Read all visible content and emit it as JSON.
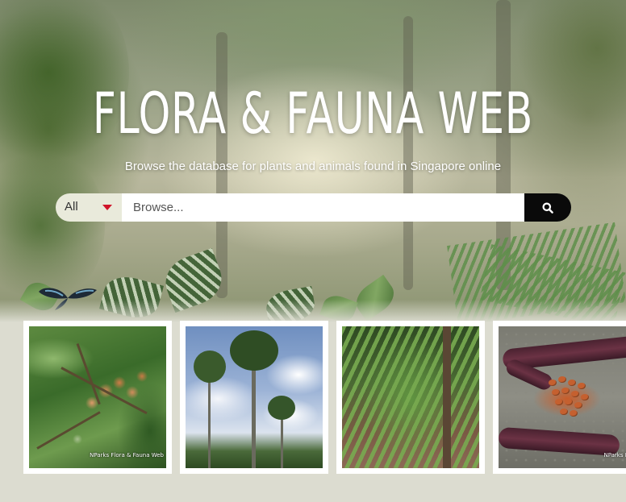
{
  "hero": {
    "title": "FLORA & FAUNA WEB",
    "subtitle": "Browse the database for plants and animals found in Singapore online"
  },
  "search": {
    "category_selected": "All",
    "placeholder": "Browse...",
    "button_icon": "search-icon",
    "caret_color": "#d0142a"
  },
  "cards": [
    {
      "image": "seed-cluster-photo",
      "credit": "NParks Flora & Fauna Web"
    },
    {
      "image": "palm-tree-sky-photo",
      "credit": ""
    },
    {
      "image": "fern-on-trunk-photo",
      "credit": ""
    },
    {
      "image": "seed-pods-photo",
      "credit": "NParks Flo"
    }
  ],
  "colors": {
    "page_background": "#dcdcd0",
    "search_button": "#0a0a0a",
    "select_background": "#e9eadb"
  }
}
